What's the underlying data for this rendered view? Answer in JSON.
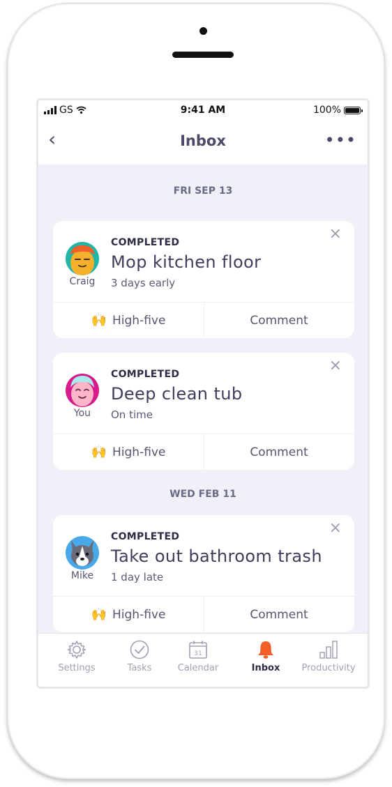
{
  "status_bar": {
    "carrier": "GS",
    "time": "9:41 AM",
    "battery": "100%"
  },
  "nav": {
    "back": "‹",
    "title": "Inbox",
    "more": "•••"
  },
  "sections": [
    {
      "date": "FRI SEP 13"
    },
    {
      "date": "WED FEB 11"
    }
  ],
  "cards": [
    {
      "person": "Craig",
      "status": "COMPLETED",
      "task": "Mop kitchen floor",
      "timing": "3 days early",
      "close": "×",
      "hands": "🙌",
      "highfive": "High-five",
      "comment": "Comment"
    },
    {
      "person": "You",
      "status": "COMPLETED",
      "task": "Deep clean tub",
      "timing": "On time",
      "close": "×",
      "hands": "🙌",
      "highfive": "High-five",
      "comment": "Comment"
    },
    {
      "person": "Mike",
      "status": "COMPLETED",
      "task": "Take out bathroom trash",
      "timing": "1 day late",
      "close": "×",
      "hands": "🙌",
      "highfive": "High-five",
      "comment": "Comment"
    }
  ],
  "tabs": [
    {
      "label": "Settings",
      "icon": "gear-icon"
    },
    {
      "label": "Tasks",
      "icon": "check-circle-icon"
    },
    {
      "label": "Calendar",
      "icon": "calendar-icon",
      "calendar_day": "31"
    },
    {
      "label": "Inbox",
      "icon": "bell-icon",
      "active": true
    },
    {
      "label": "Productivity",
      "icon": "bar-chart-icon"
    }
  ],
  "colors": {
    "accent": "#f25f2a",
    "text": "#3e3e5c",
    "background": "#f0f0f9",
    "highfive_icon": "#f5a623"
  }
}
